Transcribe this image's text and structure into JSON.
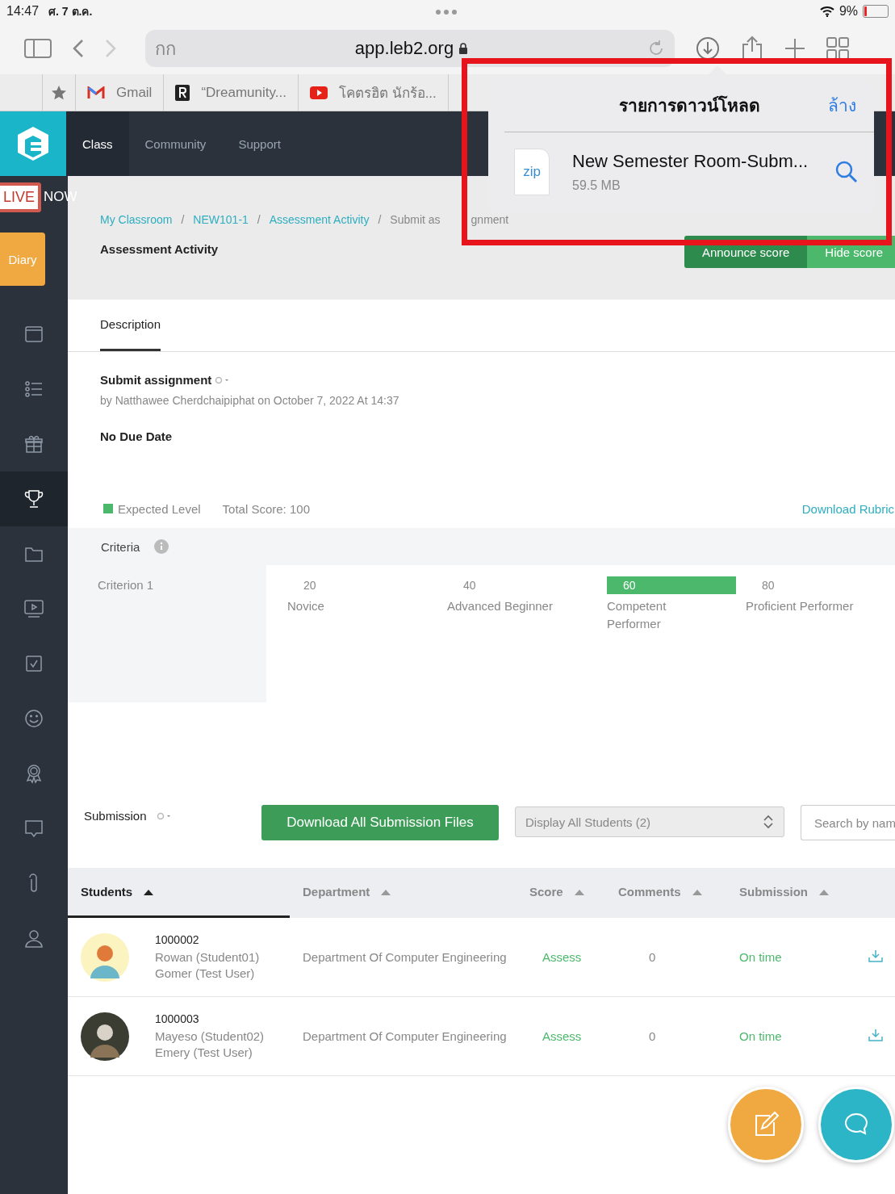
{
  "status_bar": {
    "time": "14:47",
    "date": "ศ. 7 ต.ค.",
    "battery": "9%"
  },
  "browser": {
    "text_size": "กก",
    "address": "app.leb2.org",
    "bookmarks": [
      {
        "kind": "star"
      },
      {
        "kind": "gmail",
        "label": "Gmail"
      },
      {
        "kind": "r",
        "label": "“Dreamunity..."
      },
      {
        "kind": "youtube",
        "label": "โคตรฮิต นักร้อ..."
      }
    ]
  },
  "downloads_popup": {
    "title": "รายการดาวน์โหลด",
    "clear": "ล้าง",
    "items": [
      {
        "type": "zip",
        "name": "New Semester Room-Subm...",
        "size": "59.5 MB"
      }
    ]
  },
  "header": {
    "tabs": [
      {
        "label": "Class",
        "selected": true
      },
      {
        "label": "Community",
        "selected": false
      },
      {
        "label": "Support",
        "selected": false
      }
    ]
  },
  "live_badge": {
    "live": "LIVE",
    "now": "NOW"
  },
  "diary": "Diary",
  "sidebar": {
    "items": [
      {
        "kind": "window",
        "selected": false
      },
      {
        "kind": "list",
        "selected": false
      },
      {
        "kind": "gift",
        "selected": false
      },
      {
        "kind": "trophy",
        "selected": true
      },
      {
        "kind": "folder",
        "selected": false
      },
      {
        "kind": "video",
        "selected": false
      },
      {
        "kind": "check",
        "selected": false
      },
      {
        "kind": "smile",
        "selected": false
      },
      {
        "kind": "award",
        "selected": false
      },
      {
        "kind": "chat",
        "selected": false
      },
      {
        "kind": "clip",
        "selected": false
      },
      {
        "kind": "user",
        "selected": false
      }
    ]
  },
  "breadcrumbs": [
    {
      "label": "My Classroom",
      "link": true
    },
    {
      "label": "NEW101-1",
      "link": true
    },
    {
      "label": "Assessment Activity",
      "link": true
    },
    {
      "label": "Submit as",
      "link": false
    }
  ],
  "breadcrumb_separator": "/",
  "breadcrumb_tail": "gnment",
  "page_title": "Assessment Activity",
  "actions": [
    "Announce score",
    "Hide score"
  ],
  "tabs": [
    {
      "label": "Description",
      "selected": true
    }
  ],
  "assignment": {
    "title": "Submit assignment",
    "byline": "by Natthawee Cherdchaipiphat on October 7, 2022 At 14:37",
    "due": "No Due Date"
  },
  "rubric": {
    "legend": "Expected Level",
    "total": "Total Score: 100",
    "download": "Download Rubric",
    "header": "Criteria",
    "rows": [
      {
        "name": "Criterion 1",
        "levels": [
          {
            "score": "20",
            "label": "Novice",
            "expected": false
          },
          {
            "score": "40",
            "label": "Advanced Beginner",
            "expected": false
          },
          {
            "score": "60",
            "label": "Competent Performer",
            "expected": true
          },
          {
            "score": "80",
            "label": "Proficient Performer",
            "expected": false
          }
        ]
      }
    ]
  },
  "submission": {
    "label": "Submission",
    "download_all": "Download All Submission Files",
    "filter": "Display All Students (2)",
    "search_placeholder": "Search by nam",
    "columns": [
      {
        "label": "Students",
        "selected": true
      },
      {
        "label": "Department",
        "selected": false
      },
      {
        "label": "Score",
        "selected": false
      },
      {
        "label": "Comments",
        "selected": false
      },
      {
        "label": "Submission",
        "selected": false
      }
    ],
    "rows": [
      {
        "id": "1000002",
        "name": "Rowan (Student01)",
        "name2": "Gomer (Test User)",
        "department": "Department Of Computer Engineering",
        "score": "Assess",
        "comments": "0",
        "status": "On time"
      },
      {
        "id": "1000003",
        "name": "Mayeso (Student02)",
        "name2": "Emery (Test User)",
        "department": "Department Of Computer Engineering",
        "score": "Assess",
        "comments": "0",
        "status": "On time"
      }
    ]
  }
}
